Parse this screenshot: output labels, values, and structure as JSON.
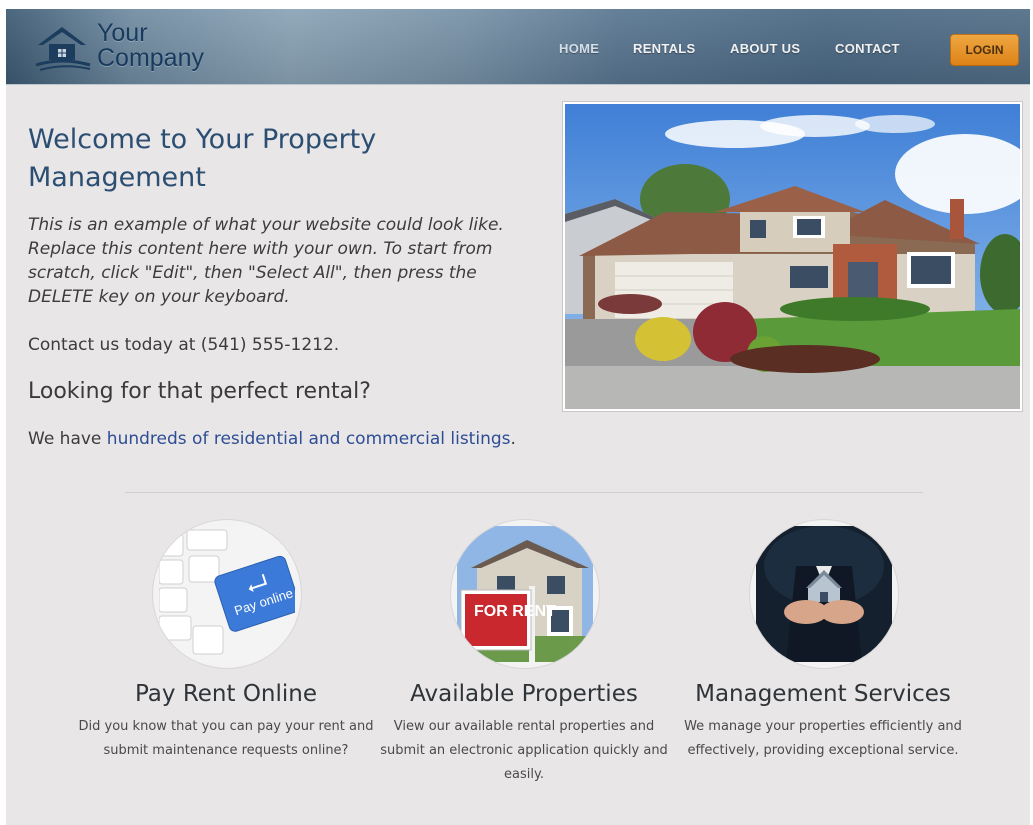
{
  "header": {
    "logo_line1": "Your",
    "logo_line2": "Company",
    "nav": [
      "HOME",
      "RENTALS",
      "ABOUT US",
      "CONTACT"
    ],
    "login_label": "LOGIN"
  },
  "main": {
    "title": "Welcome to Your Property Management",
    "intro": "This is an example of what your website could look like. Replace this content here with your own. To start from scratch, click \"Edit\", then \"Select All\", then press the DELETE key on your keyboard.",
    "contact": "Contact us today at (541) 555-1212.",
    "subheading": "Looking for that perfect rental?",
    "listing_prefix": "We have ",
    "listing_link": "hundreds of residential and commercial listings",
    "listing_suffix": "."
  },
  "features": [
    {
      "title": "Pay Rent Online",
      "description": "Did you know that you can pay your rent and submit maintenance requests online?",
      "icon": "pay-online-keyboard-icon",
      "image_text": "Pay online"
    },
    {
      "title": "Available Properties",
      "description": "View our available rental properties and submit an electronic application quickly and easily.",
      "icon": "for-rent-sign-icon",
      "image_text": "FOR RENT"
    },
    {
      "title": "Management Services",
      "description": "We manage your properties efficiently and effectively, providing exceptional service.",
      "icon": "hands-house-icon"
    }
  ],
  "colors": {
    "accent": "#2b4e72",
    "login": "#ef8a13",
    "link": "#2d4d94",
    "background": "#e8e6e7"
  }
}
